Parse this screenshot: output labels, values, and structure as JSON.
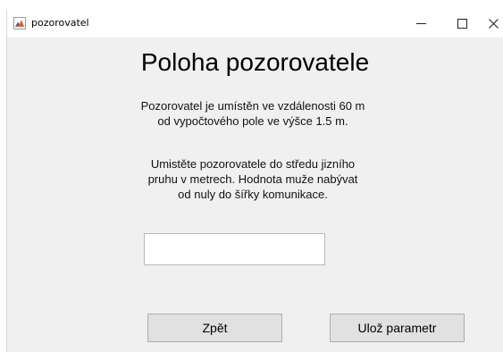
{
  "window": {
    "title": "pozorovatel",
    "controls": {
      "minimize": "—",
      "maximize": "☐",
      "close": "✕"
    }
  },
  "main": {
    "heading": "Poloha pozorovatele",
    "paragraph1": "Pozorovatel je umístěn ve vzdálenosti 60 m\nod vypočtového pole ve výšce 1.5 m.",
    "paragraph2": "Umistěte pozorovatele do středu jizního\npruhu v metrech. Hodnota muže nabývat\nod nuly do šířky komunikace.",
    "input_value": ""
  },
  "buttons": {
    "back": "Zpět",
    "save": "Ulož parametr"
  },
  "icons": {
    "app": "matlab-figure-icon"
  }
}
